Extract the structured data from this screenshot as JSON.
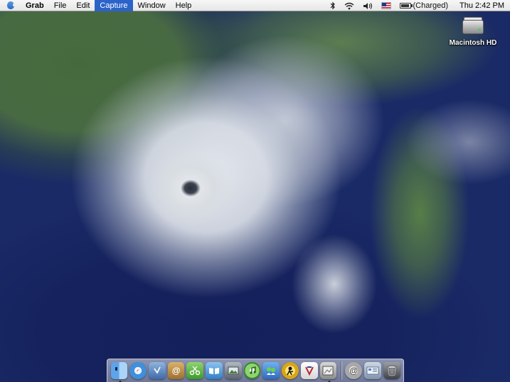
{
  "menubar": {
    "app_name": "Grab",
    "items": [
      "File",
      "Edit",
      "Capture",
      "Window",
      "Help"
    ],
    "active_item": "Capture",
    "battery_status": "(Charged)",
    "clock": "Thu 2:42 PM"
  },
  "desktop": {
    "icons": [
      {
        "label": "Macintosh HD",
        "icon": "hard-drive-icon"
      }
    ]
  },
  "dock": {
    "items": [
      {
        "name": "finder",
        "icon": "finder-icon",
        "running": true
      },
      {
        "name": "safari",
        "icon": "compass-icon",
        "running": false
      },
      {
        "name": "mail",
        "icon": "stamp-icon",
        "running": false
      },
      {
        "name": "address-book",
        "icon": "address-book-icon",
        "running": false
      },
      {
        "name": "scissors",
        "icon": "scissors-icon",
        "running": false
      },
      {
        "name": "ibook",
        "icon": "book-icon",
        "running": false
      },
      {
        "name": "iphoto",
        "icon": "photo-icon",
        "running": false
      },
      {
        "name": "itunes",
        "icon": "music-icon",
        "running": false
      },
      {
        "name": "ichat",
        "icon": "chat-icon",
        "running": false
      },
      {
        "name": "aim",
        "icon": "aim-icon",
        "running": false
      },
      {
        "name": "tools",
        "icon": "tools-icon",
        "running": false
      },
      {
        "name": "grab",
        "icon": "grab-icon",
        "running": true
      },
      {
        "name": "network",
        "icon": "network-icon",
        "running": false
      },
      {
        "name": "preferences",
        "icon": "preferences-icon",
        "running": false
      },
      {
        "name": "trash",
        "icon": "trash-icon",
        "running": false
      }
    ]
  }
}
